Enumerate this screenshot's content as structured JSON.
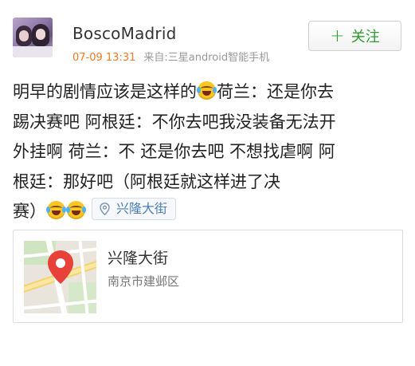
{
  "post": {
    "username": "BoscoMadrid",
    "time": "07-09 13:31",
    "source": "来自:三星android智能手机",
    "follow_label": "关注",
    "lines": [
      "明早的剧情应该是这样的",
      "荷兰：还是你去",
      "踢决赛吧 阿根廷：不你去吧我没装备无法开",
      "外挂啊 荷兰：不 还是你去吧 不想找虐啊 阿",
      "根廷：那好吧（阿根廷就这样进了决",
      "赛）"
    ],
    "location_label": "兴隆大街"
  },
  "place": {
    "name": "兴隆大街",
    "address": "南京市建邺区"
  },
  "icons": {
    "emoji": "crying-laughing-emoji-icon",
    "location": "location-pin-icon",
    "map_pin": "map-marker-icon"
  },
  "colors": {
    "time": "#f07b24",
    "follow": "#2e9b2e",
    "location_chip": "#4a7fb6",
    "pin": "#e8413a"
  }
}
